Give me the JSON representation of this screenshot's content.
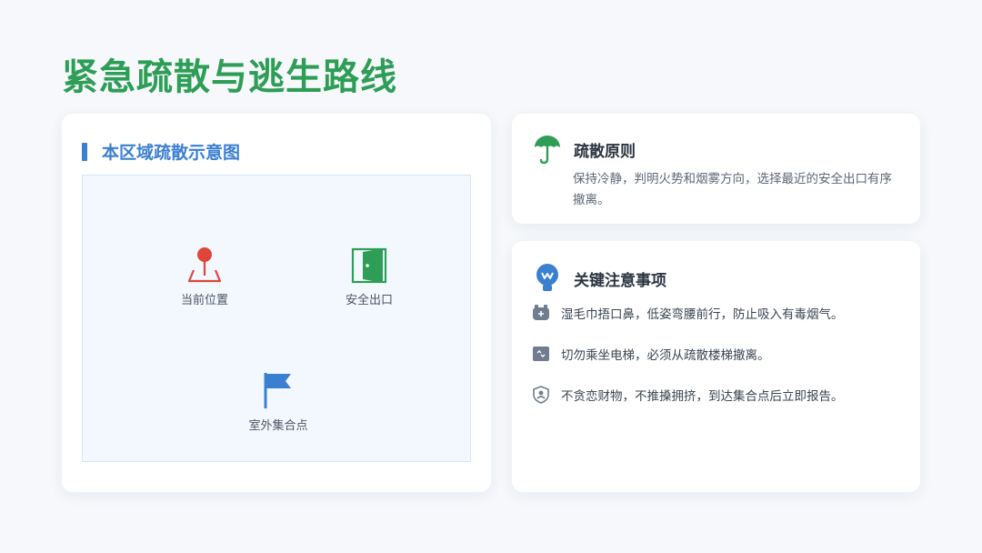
{
  "title": "紧急疏散与逃生路线",
  "map_card": {
    "title": "本区域疏散示意图",
    "markers": [
      {
        "label": "当前位置",
        "icon": "location-pin-icon"
      },
      {
        "label": "安全出口",
        "icon": "exit-door-icon"
      },
      {
        "label": "室外集合点",
        "icon": "flag-icon"
      }
    ]
  },
  "principles": {
    "title": "疏散原则",
    "icon": "umbrella-icon",
    "text": "保持冷静，判明火势和烟雾方向，选择最近的安全出口有序撤离。"
  },
  "notes": {
    "title": "关键注意事项",
    "icon": "lightbulb-icon",
    "items": [
      {
        "text": "湿毛巾捂口鼻，低姿弯腰前行，防止吸入有毒烟气。",
        "icon": "mask-icon"
      },
      {
        "text": "切勿乘坐电梯，必须从疏散楼梯撤离。",
        "icon": "elevator-icon"
      },
      {
        "text": "不贪恋财物，不推搡拥挤，到达集合点后立即报告。",
        "icon": "shield-user-icon"
      }
    ]
  },
  "colors": {
    "title": "#2e9e57",
    "accent": "#3b7fd1",
    "pin": "#e0453a",
    "exit": "#2e9e57"
  }
}
